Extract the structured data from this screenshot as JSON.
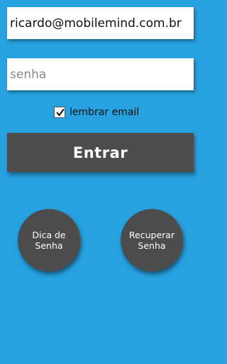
{
  "login": {
    "email_value": "ricardo@mobilemind.com.br",
    "password_placeholder": "senha",
    "remember_label": "lembrar email",
    "remember_checked": true,
    "submit_label": "Entrar"
  },
  "actions": {
    "hint_line1": "Dica de",
    "hint_line2": "Senha",
    "recover_line1": "Recuperar",
    "recover_line2": "Senha"
  },
  "colors": {
    "background": "#27a1e0",
    "button": "#4c4c4c"
  }
}
